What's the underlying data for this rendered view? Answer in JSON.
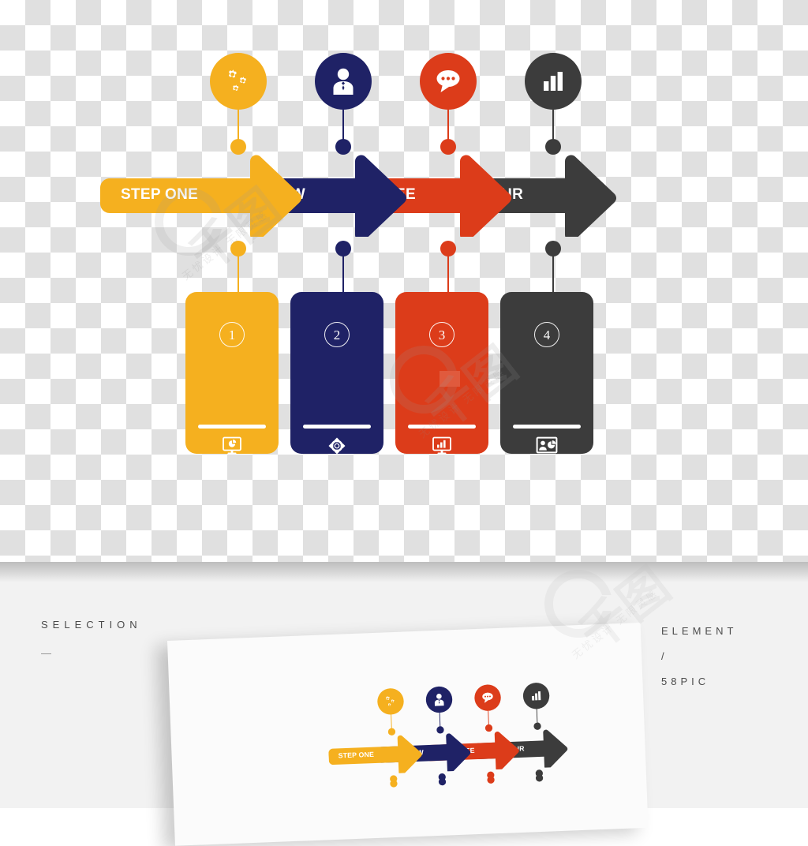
{
  "palette": {
    "amber": "#F5B01F",
    "navy": "#1F2266",
    "red": "#DC3C1A",
    "dark": "#3C3C3C",
    "white": "#FFFFFF"
  },
  "infographic": {
    "steps": [
      {
        "number": "1",
        "arrow_label": "STEP ONE",
        "color": "#F5B01F",
        "top_icon": "gears-icon",
        "card_icon": "monitor-pie-chart-icon"
      },
      {
        "number": "2",
        "arrow_label": "STEP TOW",
        "color": "#1F2266",
        "top_icon": "businessman-icon",
        "card_icon": "sync-arrows-icon"
      },
      {
        "number": "3",
        "arrow_label": "STEP TREE",
        "color": "#DC3C1A",
        "top_icon": "speech-bubble-icon",
        "card_icon": "monitor-bar-chart-icon"
      },
      {
        "number": "4",
        "arrow_label": "STEP FOUR",
        "color": "#3C3C3C",
        "top_icon": "bar-chart-icon",
        "card_icon": "presentation-board-icon"
      }
    ]
  },
  "footer": {
    "left_title": "SELECTION",
    "left_dash": "—",
    "right_lines": [
      "ELEMENT",
      "/",
      "58PIC"
    ]
  },
  "watermark": {
    "brand": "千图",
    "tagline": "无忧设计 无限灵感",
    "tagline_alt": "无忧设计 无限灵感"
  }
}
